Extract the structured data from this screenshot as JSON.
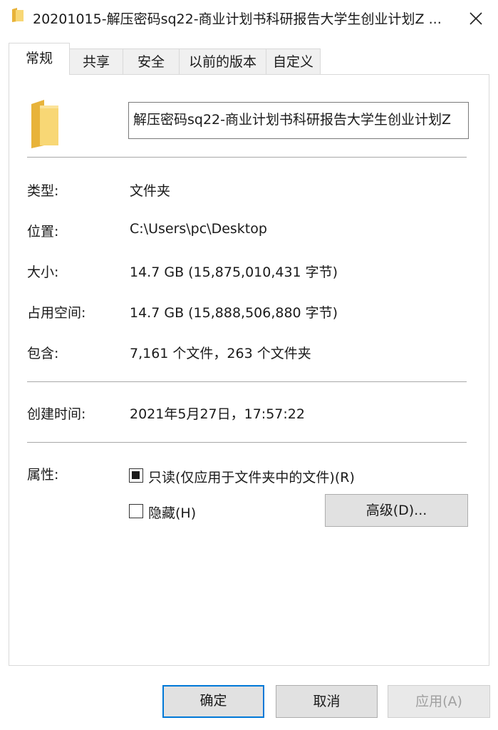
{
  "window": {
    "title": "20201015-解压密码sq22-商业计划书科研报告大学生创业计划Z ..."
  },
  "tabs": [
    {
      "label": "常规",
      "active": true
    },
    {
      "label": "共享",
      "active": false
    },
    {
      "label": "安全",
      "active": false
    },
    {
      "label": "以前的版本",
      "active": false
    },
    {
      "label": "自定义",
      "active": false
    }
  ],
  "general": {
    "name_value": "解压密码sq22-商业计划书科研报告大学生创业计划Z",
    "rows": [
      {
        "label": "类型:",
        "value": "文件夹"
      },
      {
        "label": "位置:",
        "value": "C:\\Users\\pc\\Desktop"
      },
      {
        "label": "大小:",
        "value": "14.7 GB (15,875,010,431 字节)"
      },
      {
        "label": "占用空间:",
        "value": "14.7 GB (15,888,506,880 字节)"
      },
      {
        "label": "包含:",
        "value": "7,161 个文件，263 个文件夹"
      }
    ],
    "created": {
      "label": "创建时间:",
      "value": "2021年5月27日，17:57:22"
    },
    "attributes": {
      "label": "属性:",
      "readonly_label": "只读(仅应用于文件夹中的文件)(R)",
      "readonly_state": "indeterminate",
      "hidden_label": "隐藏(H)",
      "hidden_state": "unchecked",
      "advanced_label": "高级(D)..."
    }
  },
  "footer": {
    "ok_label": "确定",
    "cancel_label": "取消",
    "apply_label": "应用(A)"
  },
  "colors": {
    "folder_yellow": "#f8d775",
    "focus_blue": "#0078d7",
    "button_gray": "#e1e1e1"
  }
}
